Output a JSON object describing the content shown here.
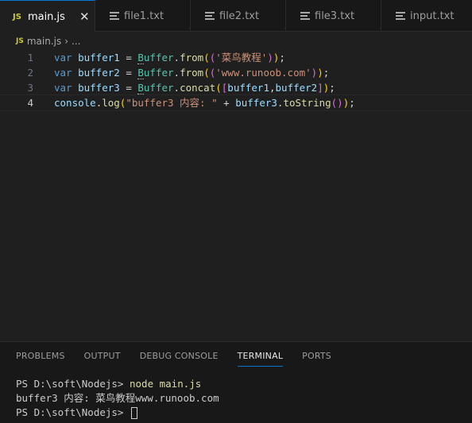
{
  "tabs": [
    {
      "icon": "JS",
      "label": "main.js",
      "active": true,
      "close": "✕"
    },
    {
      "label": "file1.txt"
    },
    {
      "label": "file2.txt"
    },
    {
      "label": "file3.txt"
    },
    {
      "label": "input.txt"
    }
  ],
  "breadcrumb": {
    "icon": "JS",
    "file": "main.js",
    "sep": "›",
    "more": "..."
  },
  "editor": {
    "line_numbers": [
      "1",
      "2",
      "3",
      "4"
    ],
    "current_line": 4,
    "lines": [
      "var buffer1 = Buffer.from(('菜鸟教程'));",
      "var buffer2 = Buffer.from(('www.runoob.com'));",
      "var buffer3 = Buffer.concat([buffer1,buffer2]);",
      "console.log(\"buffer3 内容: \" + buffer3.toString());"
    ]
  },
  "panel": {
    "tabs": [
      "PROBLEMS",
      "OUTPUT",
      "DEBUG CONSOLE",
      "TERMINAL",
      "PORTS"
    ],
    "active_tab": "TERMINAL"
  },
  "terminal": {
    "prompt1": "PS D:\\soft\\Nodejs> ",
    "command": "node main.js",
    "output": "buffer3 内容: 菜鸟教程www.runoob.com",
    "prompt2": "PS D:\\soft\\Nodejs> "
  },
  "colors": {
    "accent": "#0078d4",
    "js_icon": "#cbcb41",
    "background": "#1f1f1f"
  }
}
